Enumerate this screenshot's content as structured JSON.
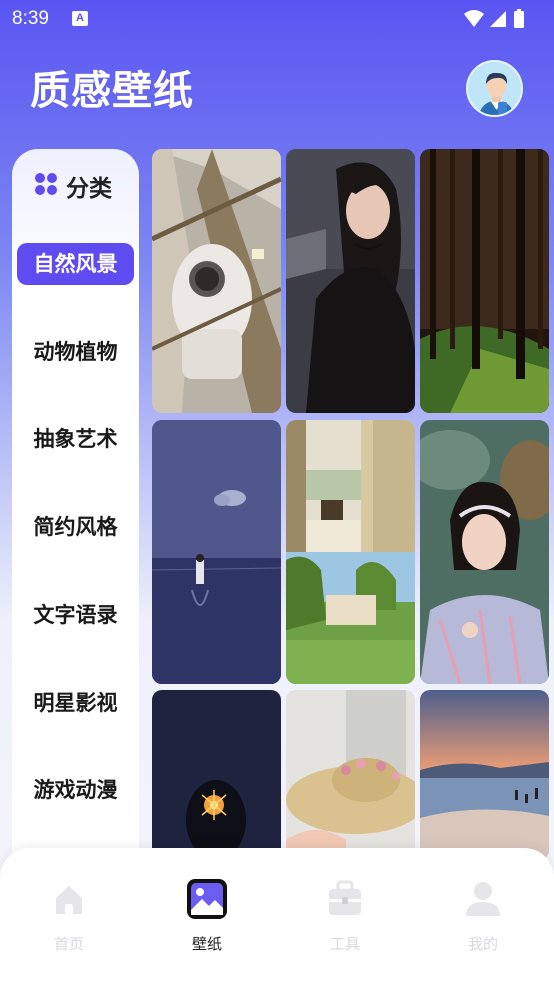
{
  "status": {
    "time": "8:39",
    "notification_glyph": "A"
  },
  "header": {
    "title": "质感壁纸"
  },
  "sidebar": {
    "header_label": "分类",
    "items": [
      {
        "label": "自然风景",
        "active": true
      },
      {
        "label": "动物植物",
        "active": false
      },
      {
        "label": "抽象艺术",
        "active": false
      },
      {
        "label": "简约风格",
        "active": false
      },
      {
        "label": "文字语录",
        "active": false
      },
      {
        "label": "明星影视",
        "active": false
      },
      {
        "label": "游戏动漫",
        "active": false
      }
    ]
  },
  "wallpapers": [
    {
      "subject": "astronaut-spacewalk"
    },
    {
      "subject": "woman-portrait-dark"
    },
    {
      "subject": "pine-forest"
    },
    {
      "subject": "girl-in-sea-blue"
    },
    {
      "subject": "balcony-and-garden"
    },
    {
      "subject": "woman-with-headband"
    },
    {
      "subject": "sparkler-night"
    },
    {
      "subject": "straw-hat-flowers"
    },
    {
      "subject": "beach-sunset"
    }
  ],
  "bottom_nav": {
    "items": [
      {
        "label": "首页",
        "icon": "home-icon"
      },
      {
        "label": "壁纸",
        "icon": "wallpaper-icon",
        "active": true
      },
      {
        "label": "工具",
        "icon": "toolbox-icon"
      },
      {
        "label": "我的",
        "icon": "profile-icon"
      }
    ]
  },
  "colors": {
    "accent": "#5e4cf0",
    "header_top": "#5a55f2",
    "inactive_nav": "#d9d9df"
  }
}
